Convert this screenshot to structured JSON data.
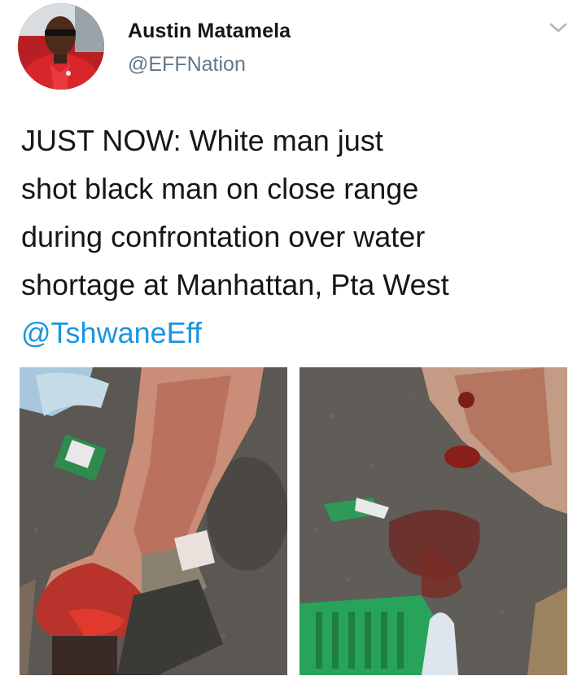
{
  "tweet": {
    "author": {
      "name": "Austin Matamela",
      "handle": "@EFFNation"
    },
    "text_lines": [
      "JUST NOW: White man just",
      "shot black man on close range",
      "during confrontation over water",
      "shortage at Manhattan, Pta West"
    ],
    "mention": "@TshwaneEff",
    "menu_icon": "chevron-down-icon",
    "colors": {
      "name": "#14171a",
      "handle": "#657786",
      "link": "#1b95e0"
    }
  }
}
